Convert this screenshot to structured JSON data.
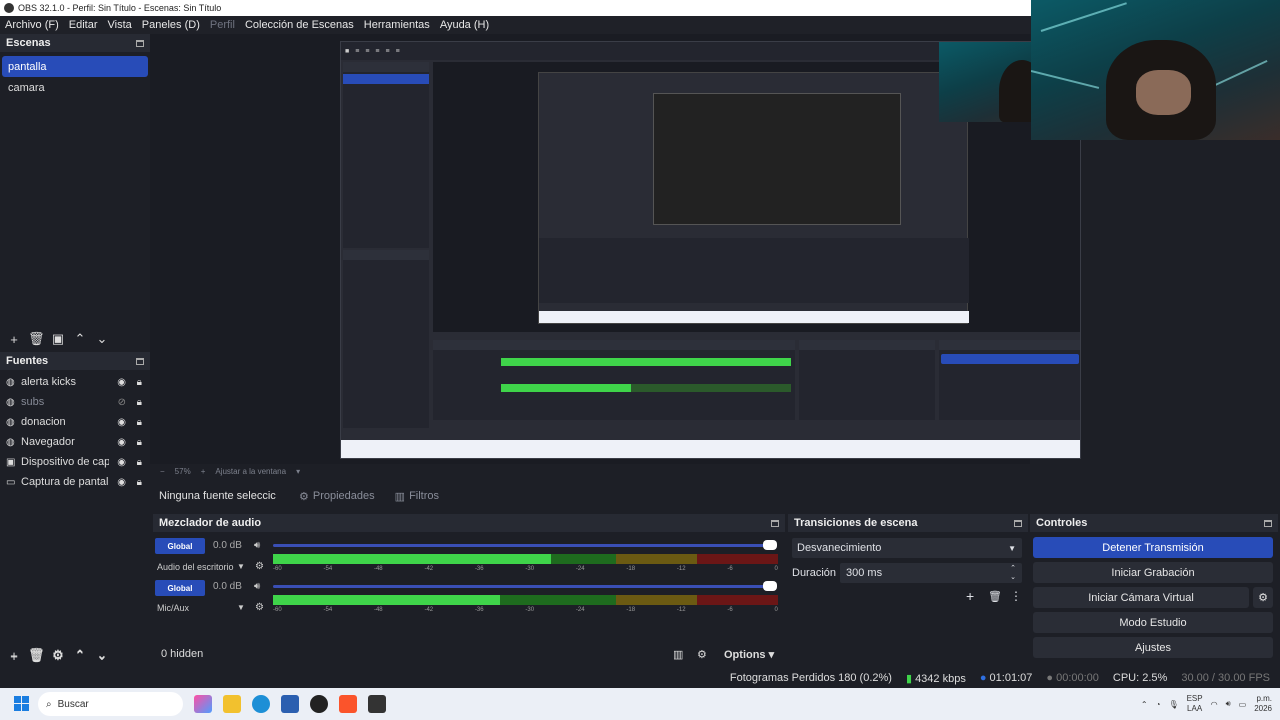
{
  "window": {
    "title": "OBS 32.1.0 - Perfil: Sin Título - Escenas: Sin Título"
  },
  "menu": [
    {
      "label": "Archivo (F)",
      "dim": false
    },
    {
      "label": "Editar",
      "dim": false
    },
    {
      "label": "Vista",
      "dim": false
    },
    {
      "label": "Paneles (D)",
      "dim": false
    },
    {
      "label": "Perfil",
      "dim": true
    },
    {
      "label": "Colección de Escenas",
      "dim": false
    },
    {
      "label": "Herramientas",
      "dim": false
    },
    {
      "label": "Ayuda (H)",
      "dim": false
    }
  ],
  "scenes": {
    "title": "Escenas",
    "items": [
      {
        "label": "pantalla",
        "active": true
      },
      {
        "label": "camara",
        "active": false
      }
    ]
  },
  "sources": {
    "title": "Fuentes",
    "items": [
      {
        "label": "alerta kicks",
        "icon": "globe-icon",
        "visible": true
      },
      {
        "label": "subs",
        "icon": "globe-icon",
        "visible": false
      },
      {
        "label": "donacion",
        "icon": "globe-icon",
        "visible": true
      },
      {
        "label": "Navegador",
        "icon": "globe-icon",
        "visible": true
      },
      {
        "label": "Dispositivo de capt",
        "icon": "camera-icon",
        "visible": true
      },
      {
        "label": "Captura de pantalla",
        "icon": "monitor-icon",
        "visible": true
      }
    ]
  },
  "preview": {
    "zoom": "57%",
    "fit_label": "Ajustar a la ventana"
  },
  "source_toolbar": {
    "no_source": "Ninguna fuente seleccic",
    "properties": "Propiedades",
    "filters": "Filtros"
  },
  "mixer": {
    "title": "Mezclador de audio",
    "global_label": "Global",
    "channels": [
      {
        "name": "Audio del escritorio",
        "db": "0.0 dB",
        "level": 0.55
      },
      {
        "name": "Mic/Aux",
        "db": "0.0 dB",
        "level": 0.45
      }
    ],
    "scale": [
      "-60",
      "-54",
      "-48",
      "-42",
      "-36",
      "-30",
      "-24",
      "-18",
      "-12",
      "-6",
      "0"
    ],
    "hidden": "0 hidden",
    "options": "Options"
  },
  "transitions": {
    "title": "Transiciones de escena",
    "selected": "Desvanecimiento",
    "duration_label": "Duración",
    "duration_value": "300 ms"
  },
  "controls": {
    "title": "Controles",
    "stop_stream": "Detener Transmisión",
    "start_recording": "Iniciar Grabación",
    "virtual_cam": "Iniciar Cámara Virtual",
    "studio_mode": "Modo Estudio",
    "settings": "Ajustes"
  },
  "status": {
    "dropped": "Fotogramas Perdidos 180 (0.2%)",
    "bitrate": "4342 kbps",
    "stream_time": "01:01:07",
    "rec_time": "00:00:00",
    "cpu": "CPU: 2.5%",
    "fps": "30.00 / 30.00 FPS"
  },
  "taskbar": {
    "search_placeholder": "Buscar",
    "lang": "ESP",
    "lang2": "LAA",
    "time": "p.m.",
    "date": "2026"
  },
  "colors": {
    "accent": "#284cb8",
    "bg": "#1d1f26",
    "panel_header": "#272a33"
  }
}
